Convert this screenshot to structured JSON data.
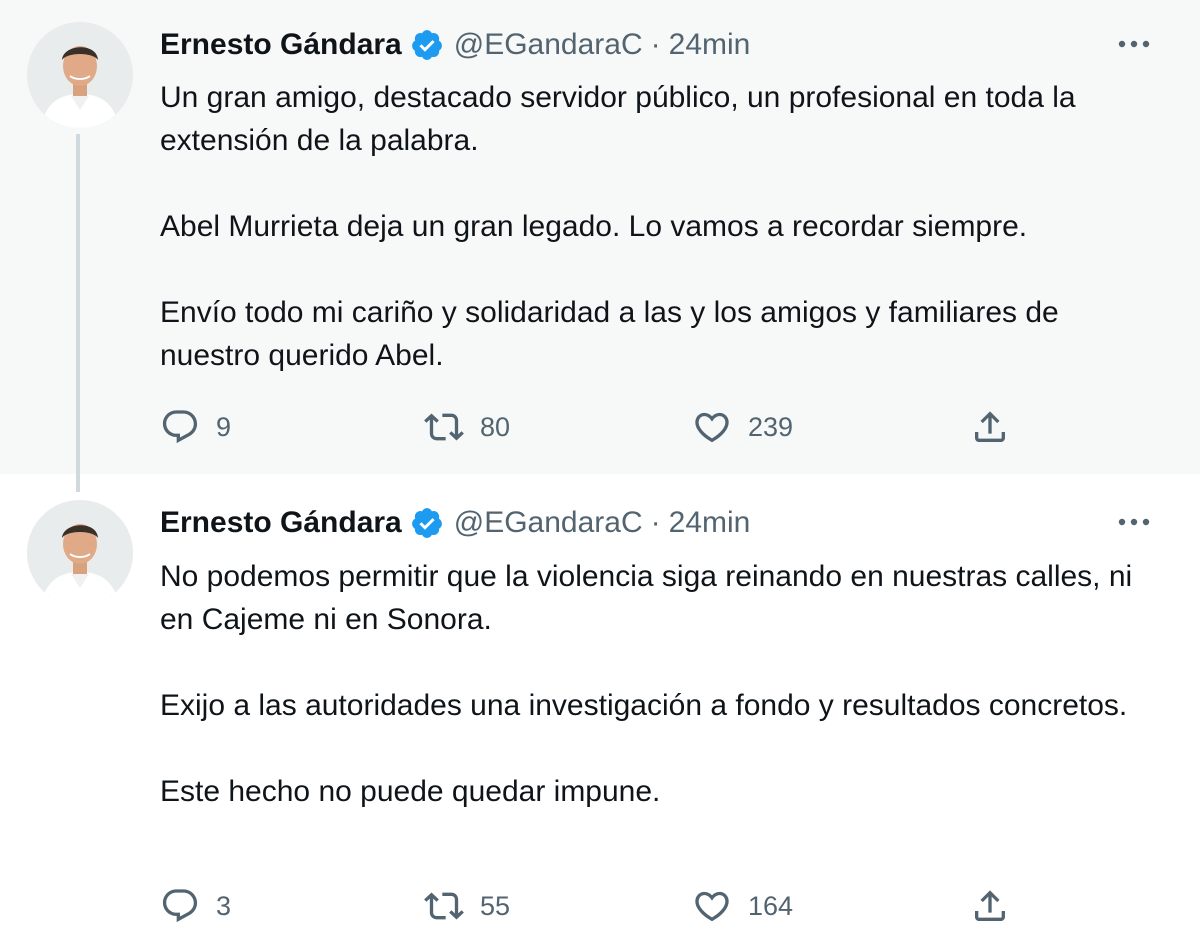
{
  "tweets": [
    {
      "author": {
        "name": "Ernesto Gándara",
        "handle": "@EGandaraC",
        "verified": true
      },
      "separator": "·",
      "time": "24min",
      "paragraphs": [
        "Un gran amigo, destacado servidor público, un profesional en toda la extensión de la palabra.",
        "Abel Murrieta deja un gran legado. Lo vamos a recordar siempre.",
        "Envío todo mi cariño y solidaridad a las y los amigos y familiares de nuestro querido Abel."
      ],
      "stats": {
        "replies": "9",
        "retweets": "80",
        "likes": "239"
      }
    },
    {
      "author": {
        "name": "Ernesto Gándara",
        "handle": "@EGandaraC",
        "verified": true
      },
      "separator": "·",
      "time": "24min",
      "paragraphs": [
        "No podemos permitir que la violencia siga reinando en nuestras calles, ni en Cajeme ni en Sonora.",
        "Exijo a las autoridades una investigación a fondo y resultados concretos.",
        "Este hecho no puede quedar impune."
      ],
      "stats": {
        "replies": "3",
        "retweets": "55",
        "likes": "164"
      }
    }
  ],
  "icons": {
    "more": "more-horizontal-icon",
    "reply": "reply-bubble-icon",
    "retweet": "retweet-arrows-icon",
    "like": "heart-icon",
    "share": "share-upload-icon",
    "verified": "verified-badge-icon"
  },
  "colors": {
    "verified_blue": "#1d9bf0",
    "secondary_text": "#536471",
    "highlight_bg": "#f7f9f9",
    "thread_line": "#cfd9de"
  }
}
